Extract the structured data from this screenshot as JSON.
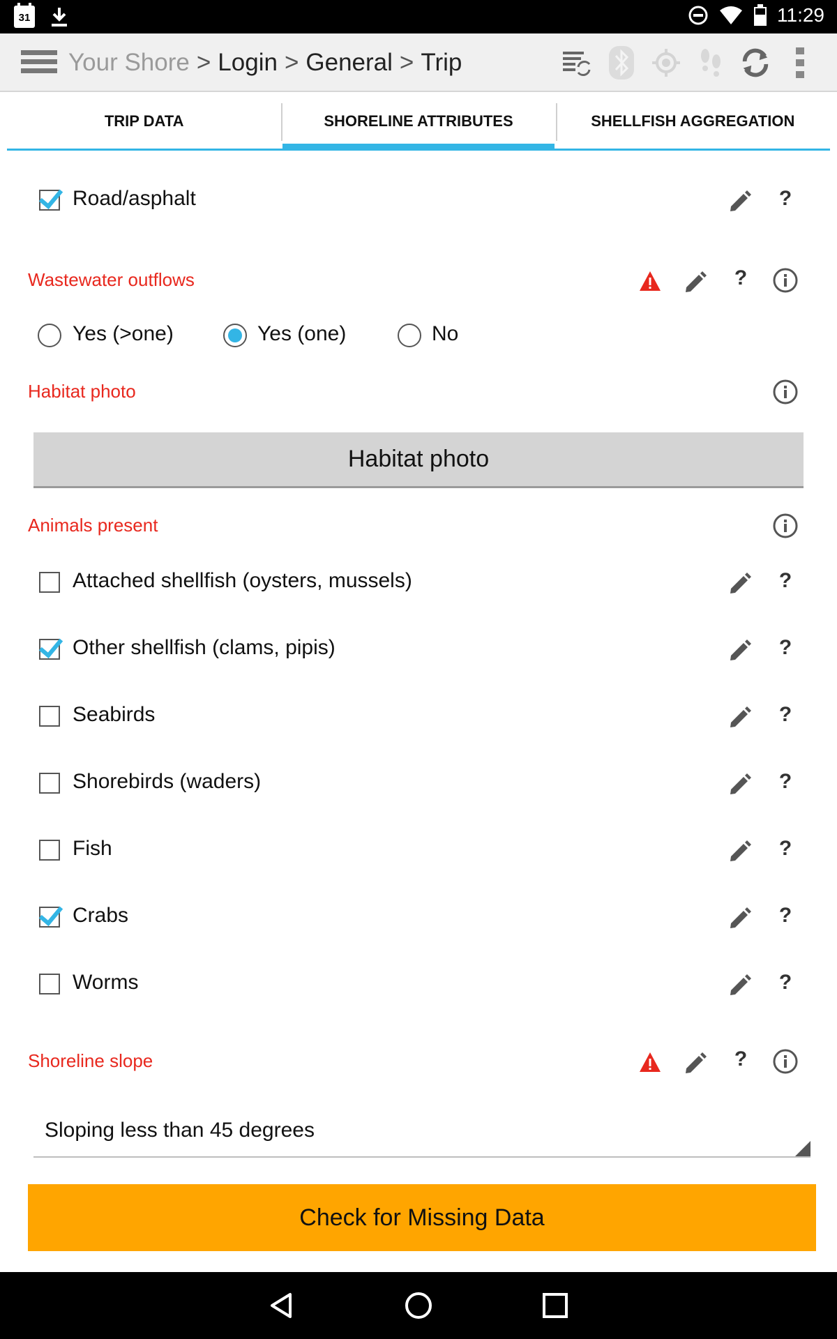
{
  "status_bar": {
    "calendar_day": "31",
    "time": "11:29",
    "icons": [
      "calendar-icon",
      "download-icon",
      "do-not-disturb-icon",
      "wifi-icon",
      "battery-icon"
    ]
  },
  "action_bar": {
    "breadcrumb": [
      {
        "label": "Your Shore",
        "dim": true
      },
      {
        "label": ">",
        "sep": true
      },
      {
        "label": "Login"
      },
      {
        "label": ">",
        "sep": true
      },
      {
        "label": "General"
      },
      {
        "label": ">",
        "sep": true
      },
      {
        "label": "Trip"
      }
    ],
    "icons": [
      "sync-list-icon",
      "bluetooth-icon",
      "gps-icon",
      "footsteps-icon",
      "refresh-icon",
      "overflow-menu-icon"
    ]
  },
  "tabs": [
    {
      "label": "TRIP DATA",
      "active": false
    },
    {
      "label": "SHORELINE ATTRIBUTES",
      "active": true
    },
    {
      "label": "SHELLFISH AGGREGATION",
      "active": false
    }
  ],
  "form": {
    "road_item": {
      "label": "Road/asphalt",
      "checked": true
    },
    "wastewater": {
      "label": "Wastewater outflows",
      "options": [
        {
          "label": "Yes (>one)",
          "selected": false
        },
        {
          "label": "Yes (one)",
          "selected": true
        },
        {
          "label": "No",
          "selected": false
        }
      ]
    },
    "habitat_photo": {
      "label": "Habitat photo",
      "button_label": "Habitat photo"
    },
    "animals": {
      "label": "Animals present",
      "items": [
        {
          "label": "Attached shellfish (oysters, mussels)",
          "checked": false
        },
        {
          "label": "Other shellfish (clams, pipis)",
          "checked": true
        },
        {
          "label": "Seabirds",
          "checked": false
        },
        {
          "label": "Shorebirds (waders)",
          "checked": false
        },
        {
          "label": "Fish",
          "checked": false
        },
        {
          "label": "Crabs",
          "checked": true
        },
        {
          "label": "Worms",
          "checked": false
        }
      ]
    },
    "shoreline_slope": {
      "label": "Shoreline slope",
      "selected_value": "Sloping less than 45 degrees"
    },
    "help_glyph": "?",
    "missing_button": "Check for Missing Data"
  },
  "colors": {
    "accent": "#33b5e5",
    "section_label": "#e8281e",
    "warning": "#e8281e",
    "missing_button": "#ffa500"
  }
}
